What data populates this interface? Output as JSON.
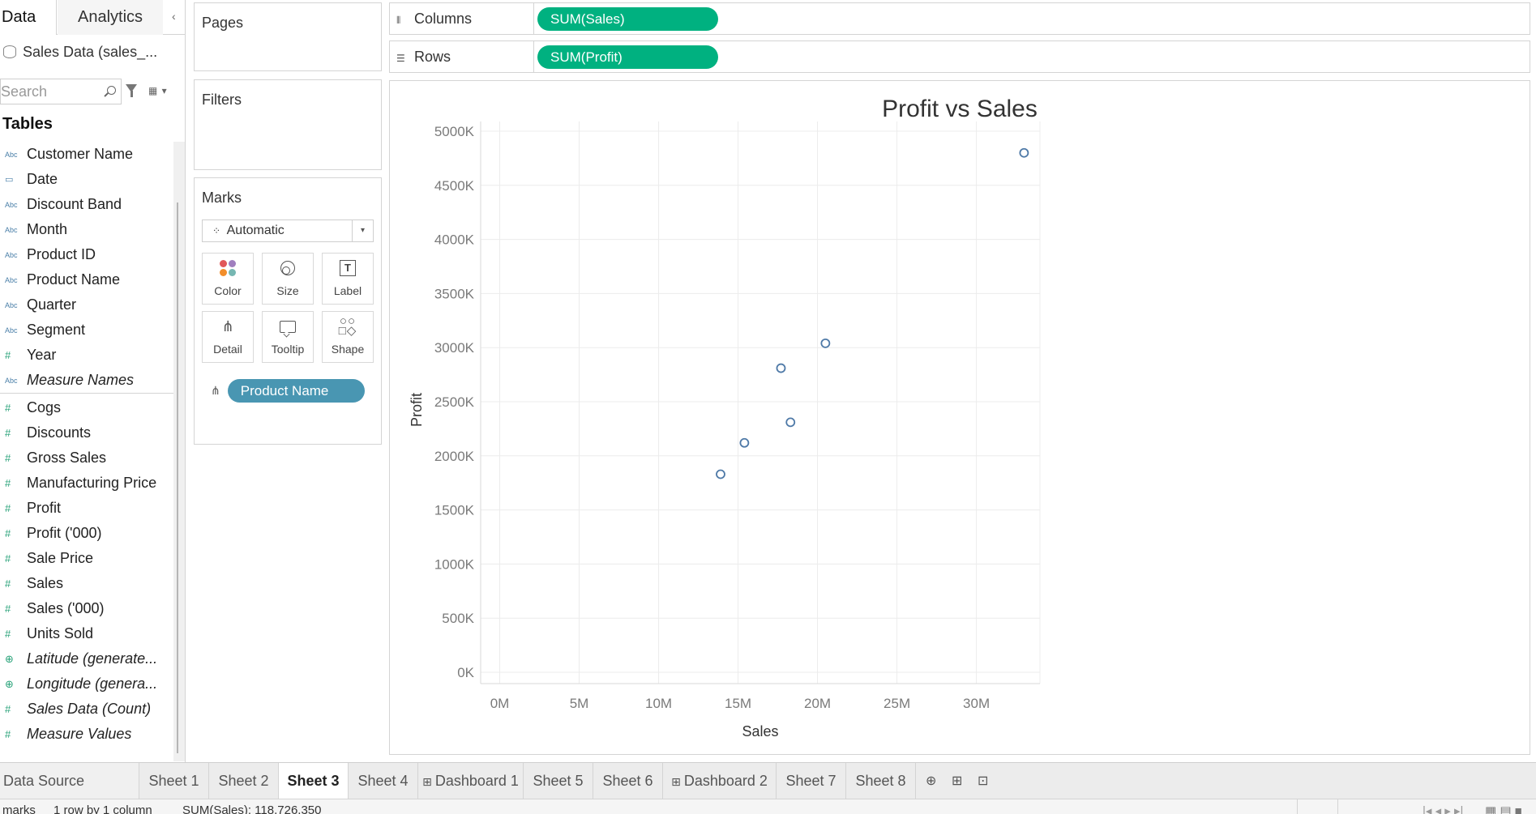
{
  "left_pane": {
    "tabs": [
      "Data",
      "Analytics"
    ],
    "collapse_glyph": "‹",
    "datasource": "Sales Data (sales_...",
    "search_placeholder": "Search",
    "tables_heading": "Tables",
    "dimensions": [
      {
        "type": "Abc",
        "name": "Customer Name"
      },
      {
        "type": "▭",
        "name": "Date"
      },
      {
        "type": "Abc",
        "name": "Discount Band"
      },
      {
        "type": "Abc",
        "name": "Month"
      },
      {
        "type": "Abc",
        "name": "Product ID"
      },
      {
        "type": "Abc",
        "name": "Product Name"
      },
      {
        "type": "Abc",
        "name": "Quarter"
      },
      {
        "type": "Abc",
        "name": "Segment"
      },
      {
        "type": "#",
        "name": "Year"
      },
      {
        "type": "Abc",
        "name": "Measure Names"
      }
    ],
    "measures": [
      {
        "type": "#",
        "name": "Cogs"
      },
      {
        "type": "#",
        "name": "Discounts"
      },
      {
        "type": "#",
        "name": "Gross Sales"
      },
      {
        "type": "#",
        "name": "Manufacturing Price"
      },
      {
        "type": "#",
        "name": "Profit"
      },
      {
        "type": "#",
        "name": "Profit ('000)"
      },
      {
        "type": "#",
        "name": "Sale Price"
      },
      {
        "type": "#",
        "name": "Sales"
      },
      {
        "type": "#",
        "name": "Sales ('000)"
      },
      {
        "type": "#",
        "name": "Units Sold"
      },
      {
        "type": "⊕",
        "name": "Latitude (generate..."
      },
      {
        "type": "⊕",
        "name": "Longitude (genera..."
      },
      {
        "type": "#",
        "name": "Sales Data (Count)"
      },
      {
        "type": "#",
        "name": "Measure Values"
      }
    ]
  },
  "cards": {
    "pages": "Pages",
    "filters": "Filters",
    "marks": "Marks",
    "mark_type": "Automatic",
    "mark_buttons": [
      "Color",
      "Size",
      "Label",
      "Detail",
      "Tooltip",
      "Shape"
    ],
    "detail_pill": "Product Name"
  },
  "shelves": {
    "columns_label": "Columns",
    "columns_pill": "SUM(Sales)",
    "rows_label": "Rows",
    "rows_pill": "SUM(Profit)"
  },
  "colors": {
    "measure_pill": "#00b180",
    "dimension_pill": "#4996b2",
    "mark_stroke": "#4e79a7"
  },
  "chart_data": {
    "type": "scatter",
    "title": "Profit vs Sales",
    "xlabel": "Sales",
    "ylabel": "Profit",
    "xlim": [
      -1.2,
      34
    ],
    "ylim": [
      0,
      5000000
    ],
    "x_ticks": [
      0,
      5,
      10,
      15,
      20,
      25,
      30
    ],
    "x_tick_labels": [
      "0M",
      "5M",
      "10M",
      "15M",
      "20M",
      "25M",
      "30M"
    ],
    "y_ticks": [
      0,
      500000,
      1000000,
      1500000,
      2000000,
      2500000,
      3000000,
      3500000,
      4000000,
      4500000,
      5000000
    ],
    "y_tick_labels": [
      "0K",
      "500K",
      "1000K",
      "1500K",
      "2000K",
      "2500K",
      "3000K",
      "3500K",
      "4000K",
      "4500K",
      "5000K"
    ],
    "grid": true,
    "points": [
      {
        "x": 13.9,
        "y": 1830000
      },
      {
        "x": 15.4,
        "y": 2120000
      },
      {
        "x": 17.7,
        "y": 2810000
      },
      {
        "x": 18.3,
        "y": 2310000
      },
      {
        "x": 20.5,
        "y": 3040000
      },
      {
        "x": 33.0,
        "y": 4800000
      }
    ]
  },
  "sheet_tabs": [
    {
      "label": "Data Source",
      "active": false,
      "dashboard": false
    },
    {
      "label": "Sheet 1",
      "active": false,
      "dashboard": false
    },
    {
      "label": "Sheet 2",
      "active": false,
      "dashboard": false
    },
    {
      "label": "Sheet 3",
      "active": true,
      "dashboard": false
    },
    {
      "label": "Sheet 4",
      "active": false,
      "dashboard": false
    },
    {
      "label": "Dashboard 1",
      "active": false,
      "dashboard": true
    },
    {
      "label": "Sheet 5",
      "active": false,
      "dashboard": false
    },
    {
      "label": "Sheet 6",
      "active": false,
      "dashboard": false
    },
    {
      "label": "Dashboard 2",
      "active": false,
      "dashboard": true
    },
    {
      "label": "Sheet 7",
      "active": false,
      "dashboard": false
    },
    {
      "label": "Sheet 8",
      "active": false,
      "dashboard": false
    }
  ],
  "status": {
    "marks": "marks",
    "rows_cols": "1 row by 1 column",
    "sum_sales": "SUM(Sales): 118,726,350"
  }
}
